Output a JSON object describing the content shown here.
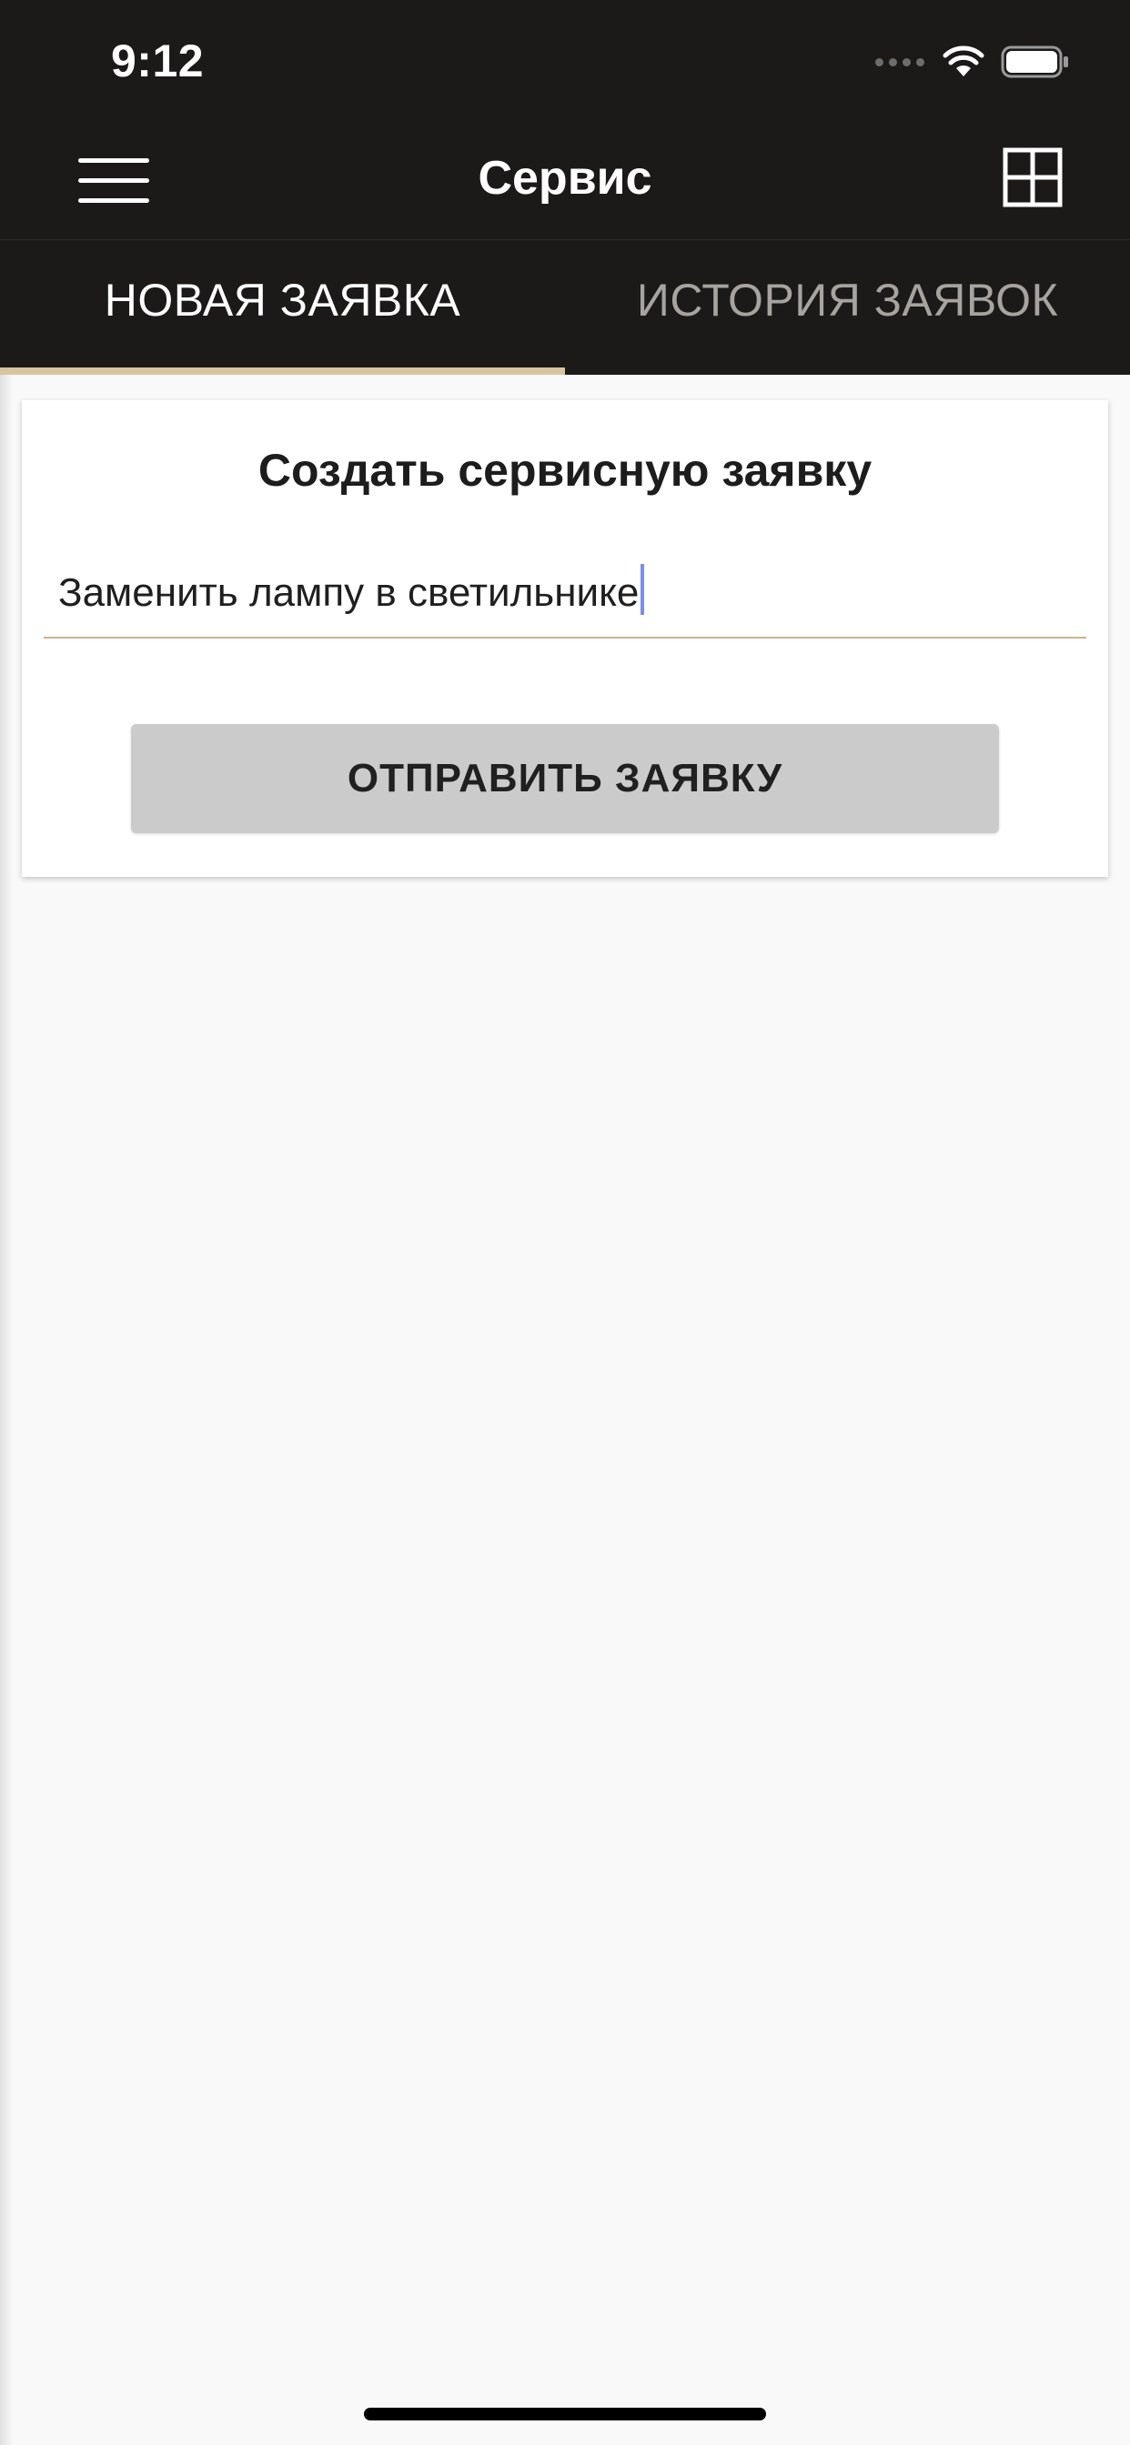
{
  "status_bar": {
    "time": "9:12"
  },
  "nav_bar": {
    "title": "Сервис",
    "menu_icon": "hamburger-menu-icon",
    "grid_icon": "grid-icon"
  },
  "tabs": [
    {
      "label": "НОВАЯ ЗАЯВКА",
      "active": true
    },
    {
      "label": "ИСТОРИЯ ЗАЯВОК",
      "active": false
    }
  ],
  "form": {
    "title": "Создать сервисную заявку",
    "request_value": "Заменить лампу в светильнике",
    "submit_label": "ОТПРАВИТЬ ЗАЯВКУ"
  },
  "colors": {
    "header_bg": "#1b1a19",
    "accent": "#d8c4a0",
    "page_bg": "#f9f9f9",
    "button_bg": "#cbcbcb"
  }
}
